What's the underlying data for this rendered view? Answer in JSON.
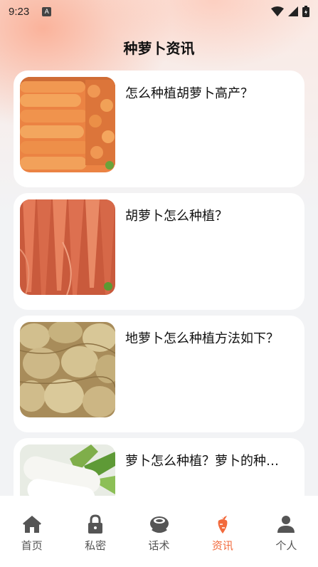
{
  "status_bar": {
    "time": "9:23",
    "notif_icon": "A"
  },
  "header": {
    "title": "种萝卜资讯"
  },
  "articles": [
    {
      "title": "怎么种植胡萝卜高产？",
      "image": "carrots-in-bag"
    },
    {
      "title": "胡萝卜怎么种植？",
      "image": "fresh-carrots"
    },
    {
      "title": "地萝卜怎么种植方法如下？",
      "image": "jicama-pile"
    },
    {
      "title": "萝卜怎么种植？萝卜的种植方法",
      "image": "white-radish"
    }
  ],
  "tabbar": {
    "items": [
      {
        "label": "首页",
        "icon": "home-icon"
      },
      {
        "label": "私密",
        "icon": "lock-icon"
      },
      {
        "label": "话术",
        "icon": "chat-bowl-icon"
      },
      {
        "label": "资讯",
        "icon": "carrot-icon",
        "active": true
      },
      {
        "label": "个人",
        "icon": "user-icon"
      }
    ]
  },
  "colors": {
    "accent": "#f26a3c",
    "background": "#f2f3f5",
    "card": "#ffffff"
  }
}
